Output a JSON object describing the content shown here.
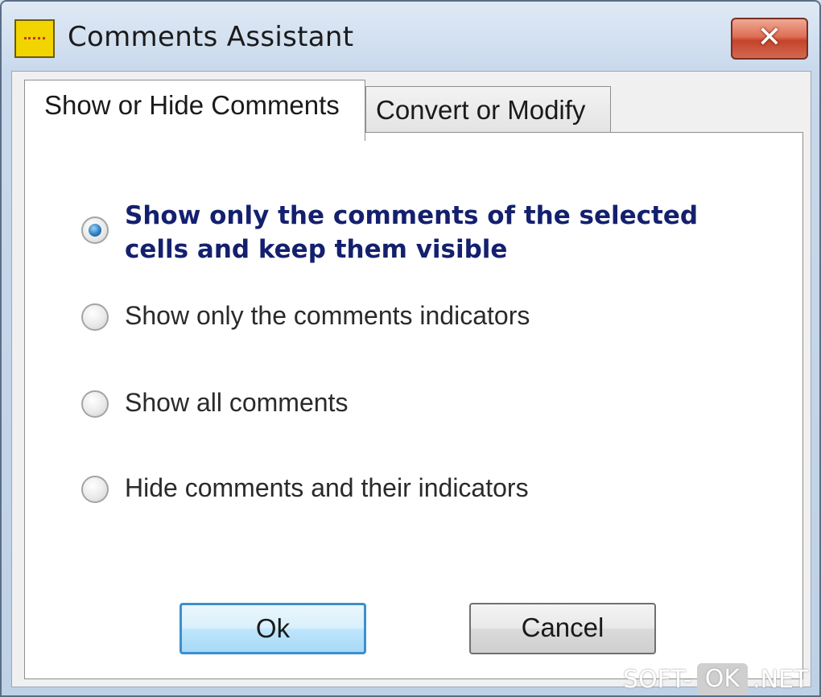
{
  "window": {
    "title": "Comments Assistant",
    "close_label": "✕"
  },
  "tabs": [
    {
      "label": "Show or Hide Comments",
      "active": true
    },
    {
      "label": "Convert or Modify",
      "active": false
    }
  ],
  "options": [
    {
      "label": "Show only the comments of the selected cells and keep them visible",
      "checked": true
    },
    {
      "label": "Show only the comments indicators",
      "checked": false
    },
    {
      "label": "Show all comments",
      "checked": false
    },
    {
      "label": "Hide comments and their indicators",
      "checked": false
    }
  ],
  "buttons": {
    "ok_label": "Ok",
    "cancel_label": "Cancel"
  },
  "watermark": {
    "left": "SOFT-",
    "middle": "OK",
    "right": ".NET"
  },
  "colors": {
    "selected_option_text": "#14206e",
    "radio_selected": "#2d7fc1",
    "close_button": "#c4432b"
  }
}
